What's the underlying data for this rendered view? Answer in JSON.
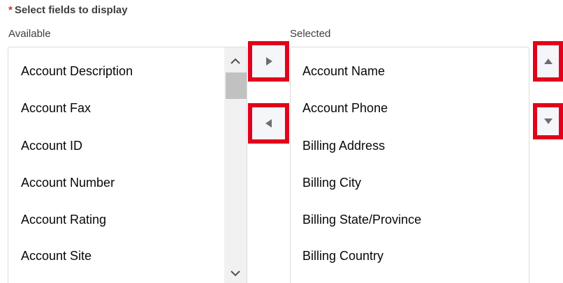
{
  "header": {
    "required_marker": "*",
    "title": "Select fields to display"
  },
  "available": {
    "label": "Available",
    "items": [
      "Account Description",
      "Account Fax",
      "Account ID",
      "Account Number",
      "Account Rating",
      "Account Site"
    ]
  },
  "selected": {
    "label": "Selected",
    "items": [
      "Account Name",
      "Account Phone",
      "Billing Address",
      "Billing City",
      "Billing State/Province",
      "Billing Country"
    ]
  },
  "icons": {
    "move_right": "triangle-right-icon",
    "move_left": "triangle-left-icon",
    "move_up": "triangle-up-icon",
    "move_down": "triangle-down-icon",
    "scroll_up": "chevron-up-icon",
    "scroll_down": "chevron-down-icon"
  },
  "colors": {
    "highlight": "#e3001b",
    "required": "#c23934"
  }
}
